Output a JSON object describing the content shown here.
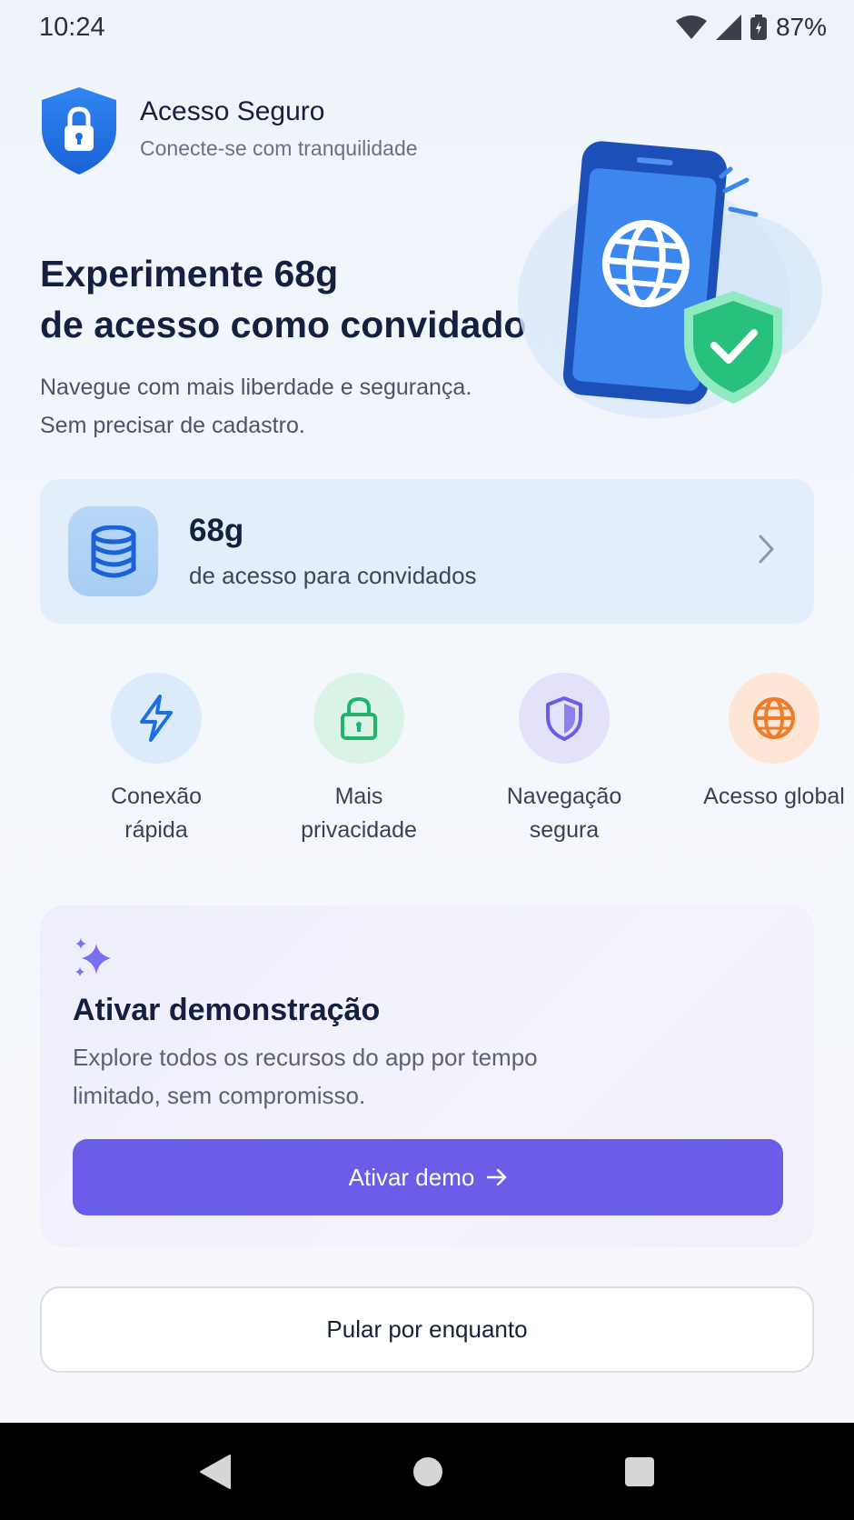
{
  "status_bar": {
    "time": "10:24",
    "battery": "87%"
  },
  "brand": {
    "name": "Acesso Seguro",
    "tagline": "Conecte-se com tranquilidade"
  },
  "hero": {
    "title_line1": "Experimente 68g",
    "title_line2": "de acesso como convidado",
    "subtitle_line1": "Navegue com mais liberdade e segurança.",
    "subtitle_line2": "Sem precisar de cadastro."
  },
  "access_card": {
    "amount": "68g",
    "description": "de acesso para convidados"
  },
  "features": [
    {
      "line1": "Conexão",
      "line2": "rápida",
      "icon": "lightning-icon",
      "bg": "#dcebfb",
      "color": "#1f6fe0"
    },
    {
      "line1": "Mais",
      "line2": "privacidade",
      "icon": "lock-icon",
      "bg": "#d9f4e6",
      "color": "#22b26a"
    },
    {
      "line1": "Navegação",
      "line2": "segura",
      "icon": "shield-icon",
      "bg": "#e4e2fa",
      "color": "#6a5ee8"
    },
    {
      "line1": "Acesso global",
      "line2": "",
      "icon": "globe-icon",
      "bg": "#fde6d6",
      "color": "#ee7d2a"
    }
  ],
  "demo": {
    "title": "Ativar demonstração",
    "description": "Explore todos os recursos do app por tempo limitado, sem compromisso.",
    "button_label": "Ativar demo"
  },
  "skip_label": "Pular por enquanto",
  "colors": {
    "primary": "#1f6fe0",
    "accent": "#6a5ee8",
    "success": "#22b26a"
  }
}
